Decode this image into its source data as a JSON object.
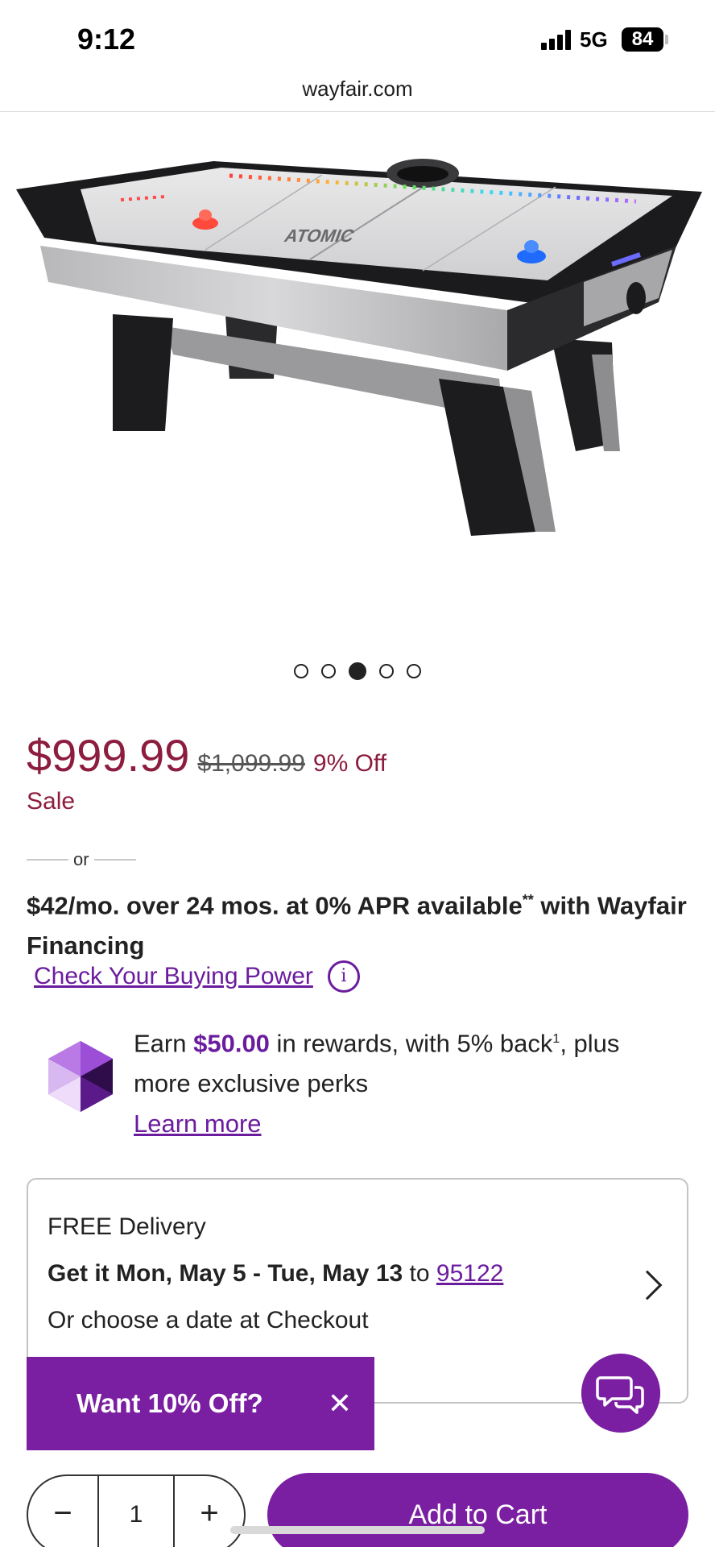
{
  "status_bar": {
    "time": "9:12",
    "network": "5G",
    "battery": "84"
  },
  "browser": {
    "url": "wayfair.com"
  },
  "product": {
    "image_alt": "air hockey table",
    "carousel": {
      "count": 5,
      "active_index": 2
    }
  },
  "pricing": {
    "price": "$999.99",
    "original_price": "$1,099.99",
    "discount": "9% Off",
    "sale_label": "Sale",
    "or_label": "or",
    "financing_main": "$42/mo. over 24 mos. at 0% APR available",
    "financing_sup": "**",
    "financing_tail": " with Wayfair Financing",
    "buying_power_link": "Check Your Buying Power"
  },
  "rewards": {
    "earn_prefix": "Earn ",
    "amount": "$50.00",
    "middle": " in rewards, with 5% back",
    "sup": "1",
    "tail": ", plus more exclusive perks",
    "learn_more": "Learn more"
  },
  "delivery": {
    "title": "FREE Delivery",
    "date_bold": "Get it Mon, May 5 - Tue, May 13",
    "date_to": " to ",
    "zip": "95122",
    "choose": "Or choose a date at Checkout"
  },
  "promo": {
    "text": "Want 10% Off?",
    "close": "✕"
  },
  "cart": {
    "minus": "−",
    "quantity": "1",
    "plus": "+",
    "add_label": "Add to Cart"
  },
  "colors": {
    "price": "#8d1d3f",
    "brand": "#7b1fa2",
    "link": "#6b1c9e"
  },
  "icons": [
    "signal-icon",
    "battery-icon",
    "info-icon",
    "rewards-gem-icon",
    "chevron-right-icon",
    "close-icon",
    "chat-icon",
    "minus-icon",
    "plus-icon"
  ]
}
